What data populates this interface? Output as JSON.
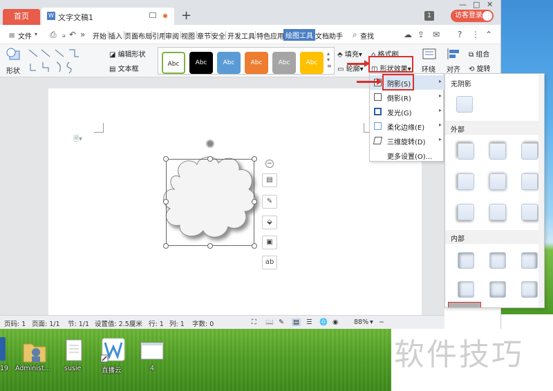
{
  "tabs": {
    "home": "首页",
    "doc": "文字文稿1",
    "add": "+"
  },
  "header": {
    "count": "1",
    "visitor_login": "访客登录"
  },
  "menu": {
    "file": "文件",
    "items": [
      "开始",
      "插入",
      "页面布局",
      "引用",
      "审阅",
      "视图",
      "章节",
      "安全",
      "开发工具",
      "特色应用",
      "绘图工具",
      "文档助手"
    ],
    "active": "绘图工具",
    "search": "查找"
  },
  "ribbon": {
    "shape": "形状",
    "edit_shape": "编辑形状",
    "text_box": "文本框",
    "style_label": "Abc",
    "fill": "填充",
    "format_brush": "格式刷",
    "outline": "轮廓",
    "shape_effect": "形状效果",
    "wrap": "环绕",
    "align": "对齐",
    "group": "组合",
    "rotate": "旋转"
  },
  "styles": [
    {
      "bg": "#ffffff",
      "fg": "#222222",
      "border": "#7cb342"
    },
    {
      "bg": "#000000",
      "fg": "#ffffff",
      "border": "#000000"
    },
    {
      "bg": "#5b9bd5",
      "fg": "#ffffff",
      "border": "#5b9bd5"
    },
    {
      "bg": "#ed7d31",
      "fg": "#ffffff",
      "border": "#ed7d31"
    },
    {
      "bg": "#a5a5a5",
      "fg": "#ffffff",
      "border": "#a5a5a5"
    },
    {
      "bg": "#ffc000",
      "fg": "#ffffff",
      "border": "#ffc000"
    }
  ],
  "effects_menu": {
    "items": [
      {
        "label": "阴影(S)",
        "has_sub": true
      },
      {
        "label": "倒影(R)",
        "has_sub": true
      },
      {
        "label": "发光(G)",
        "has_sub": true
      },
      {
        "label": "柔化边缘(E)",
        "has_sub": true
      },
      {
        "label": "三维旋转(D)",
        "has_sub": true
      },
      {
        "label": "更多设置(O)...",
        "has_sub": false
      }
    ]
  },
  "shadow_panel": {
    "none": "无阴影",
    "outer": "外部",
    "inner": "内部"
  },
  "status": {
    "page": "页码: 1",
    "pages": "页面: 1/1",
    "section": "节: 1/1",
    "setting": "设置值: 2.5厘米",
    "row": "行: 1",
    "col": "列: 1",
    "chars": "字数: 0",
    "zoom": "88%"
  },
  "desktop_icons": [
    {
      "label": "19"
    },
    {
      "label": "Administ..."
    },
    {
      "label": "susie"
    },
    {
      "label": "直播云"
    },
    {
      "label": "4"
    }
  ],
  "watermark": "软件技巧"
}
